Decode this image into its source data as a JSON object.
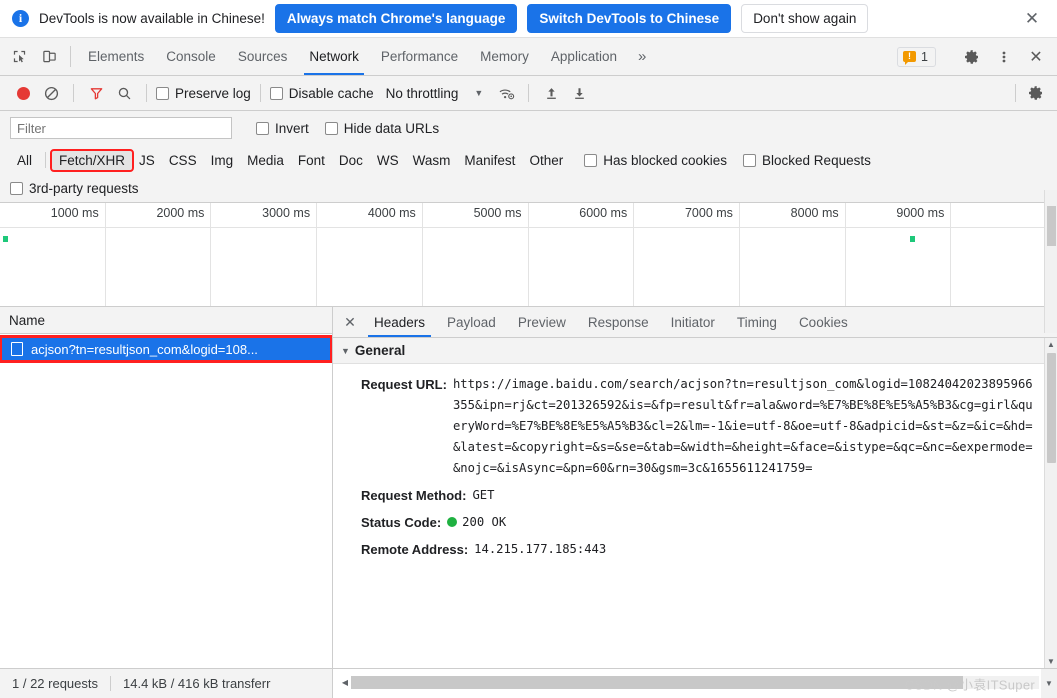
{
  "banner": {
    "info_icon": "info-icon",
    "message": "DevTools is now available in Chinese!",
    "primary_button": "Always match Chrome's language",
    "secondary_button": "Switch DevTools to Chinese",
    "dismiss_button": "Don't show again",
    "close_icon": "✕",
    "accent_color": "#1a73e8"
  },
  "tabbar": {
    "inspect_icon": "inspect-element-icon",
    "device_icon": "device-toolbar-icon",
    "tabs": [
      {
        "label": "Elements",
        "active": false
      },
      {
        "label": "Console",
        "active": false
      },
      {
        "label": "Sources",
        "active": false
      },
      {
        "label": "Network",
        "active": true
      },
      {
        "label": "Performance",
        "active": false
      },
      {
        "label": "Memory",
        "active": false
      },
      {
        "label": "Application",
        "active": false
      }
    ],
    "more_tabs_icon": "»",
    "warning_count": "1",
    "warning_icon": "warning-bubble-icon",
    "settings_icon": "gear-icon",
    "menu_icon": "kebab-menu-icon",
    "close_icon": "✕"
  },
  "nettool": {
    "record_icon": "record-button",
    "clear_icon": "clear-icon",
    "filter_icon": "filter-funnel-icon",
    "search_icon": "search-icon",
    "preserve_log": "Preserve log",
    "disable_cache": "Disable cache",
    "throttling": "No throttling",
    "throttle_caret": "▼",
    "wifi_icon": "network-conditions-icon",
    "import_icon": "import-har-icon",
    "export_icon": "export-har-icon",
    "settings_icon": "network-settings-gear-icon"
  },
  "filterrow": {
    "placeholder": "Filter",
    "value": "",
    "invert": "Invert",
    "hide_data_urls": "Hide data URLs"
  },
  "typerow": {
    "types": [
      {
        "label": "All",
        "active": false
      },
      {
        "label": "Fetch/XHR",
        "active": true
      },
      {
        "label": "JS",
        "active": false
      },
      {
        "label": "CSS",
        "active": false
      },
      {
        "label": "Img",
        "active": false
      },
      {
        "label": "Media",
        "active": false
      },
      {
        "label": "Font",
        "active": false
      },
      {
        "label": "Doc",
        "active": false
      },
      {
        "label": "WS",
        "active": false
      },
      {
        "label": "Wasm",
        "active": false
      },
      {
        "label": "Manifest",
        "active": false
      },
      {
        "label": "Other",
        "active": false
      }
    ],
    "has_blocked_cookies": "Has blocked cookies",
    "blocked_requests": "Blocked Requests",
    "third_party_requests": "3rd-party requests",
    "annotation_color": "#ff2020"
  },
  "overview": {
    "ticks": [
      "1000 ms",
      "2000 ms",
      "3000 ms",
      "4000 ms",
      "5000 ms",
      "6000 ms",
      "7000 ms",
      "8000 ms",
      "9000 ms"
    ],
    "marker_color": "#1ec87a",
    "markers": [
      {
        "left_pct": 0.25
      },
      {
        "left_pct": 86.1
      }
    ]
  },
  "requestlist": {
    "column_header": "Name",
    "rows": [
      {
        "icon": "document-icon",
        "name": "acjson?tn=resultjson_com&logid=108...",
        "selected": true
      }
    ]
  },
  "detail": {
    "close_icon": "✕",
    "tabs": [
      {
        "label": "Headers",
        "active": true
      },
      {
        "label": "Payload",
        "active": false
      },
      {
        "label": "Preview",
        "active": false
      },
      {
        "label": "Response",
        "active": false
      },
      {
        "label": "Initiator",
        "active": false
      },
      {
        "label": "Timing",
        "active": false
      },
      {
        "label": "Cookies",
        "active": false
      }
    ],
    "section_title": "General",
    "section_triangle": "▼",
    "fields": [
      {
        "key": "Request URL:",
        "value": "https://image.baidu.com/search/acjson?tn=resultjson_com&logid=10824042023895966355&ipn=rj&ct=201326592&is=&fp=result&fr=ala&word=%E7%BE%8E%E5%A5%B3&cg=girl&queryWord=%E7%BE%8E%E5%A5%B3&cl=2&lm=-1&ie=utf-8&oe=utf-8&adpicid=&st=&z=&ic=&hd=&latest=&copyright=&s=&se=&tab=&width=&height=&face=&istype=&qc=&nc=&expermode=&nojc=&isAsync=&pn=60&rn=30&gsm=3c&1655611241759="
      },
      {
        "key": "Request Method:",
        "value": "GET"
      },
      {
        "key": "Status Code:",
        "value": "200  OK",
        "status_dot": "#1fb141"
      },
      {
        "key": "Remote Address:",
        "value": "14.215.177.185:443"
      }
    ]
  },
  "statusbar": {
    "requests": "1 / 22 requests",
    "transferred": "14.4 kB / 416 kB transferr",
    "watermark": "CSDN @小袁ITSuper"
  }
}
